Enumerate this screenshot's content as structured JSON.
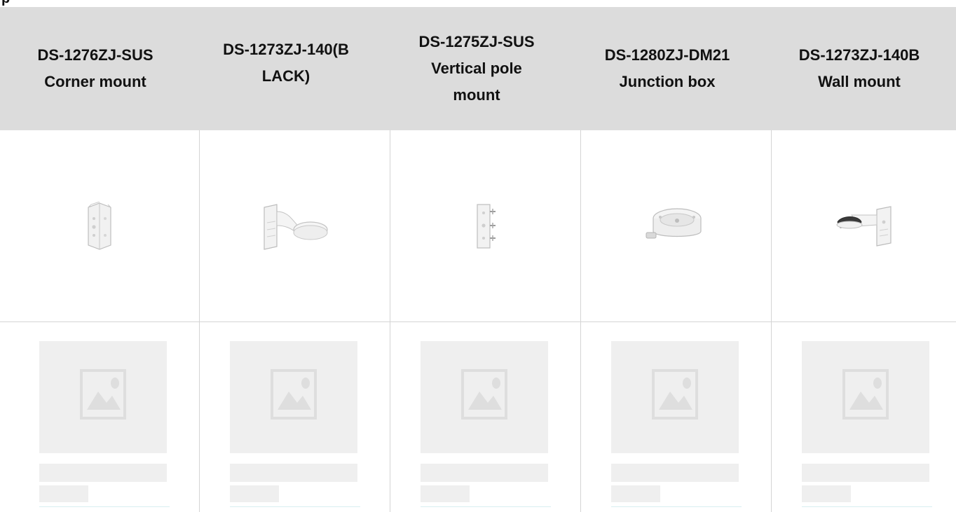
{
  "page": {
    "top_fragment_text": "p"
  },
  "products": [
    {
      "model": "DS-1276ZJ-SUS",
      "header_lines": [
        "DS-1276ZJ-SUS",
        "Corner mount"
      ],
      "icon": "corner-mount-bracket-icon"
    },
    {
      "model": "DS-1273ZJ-140(BLACK)",
      "header_lines": [
        "DS-1273ZJ-140(B",
        "LACK)"
      ],
      "icon": "wall-mount-dome-bracket-icon"
    },
    {
      "model": "DS-1275ZJ-SUS",
      "header_lines": [
        "DS-1275ZJ-SUS",
        "Vertical pole",
        "mount"
      ],
      "icon": "vertical-pole-mount-icon"
    },
    {
      "model": "DS-1280ZJ-DM21",
      "header_lines": [
        "DS-1280ZJ-DM21",
        "Junction box"
      ],
      "icon": "junction-box-icon"
    },
    {
      "model": "DS-1273ZJ-140B",
      "header_lines": [
        "DS-1273ZJ-140B",
        "Wall mount"
      ],
      "icon": "wall-mount-bracket-icon"
    }
  ],
  "placeholders": {
    "count": 5,
    "icon": "image-placeholder-icon"
  },
  "colors": {
    "header_bg": "#dcdcdc",
    "grid_line": "#d4d4d4",
    "placeholder": "#efefef",
    "placeholder_icon": "#dedede",
    "underline_accent": "#d8eef0",
    "text": "#111111"
  }
}
